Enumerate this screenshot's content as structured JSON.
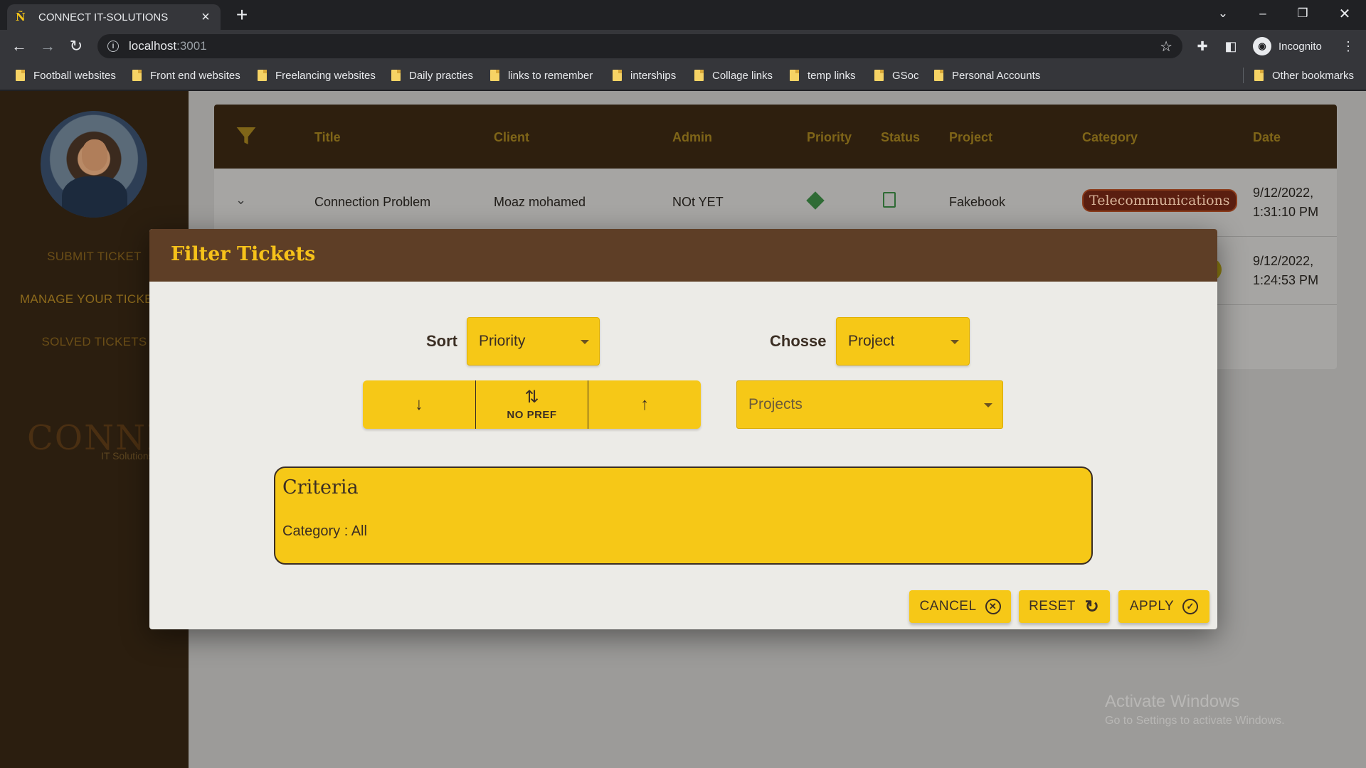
{
  "browser": {
    "tab_title": "CONNECT IT-SOLUTIONS",
    "url_host": "localhost",
    "url_port": ":3001",
    "profile_label": "Incognito",
    "bookmarks": [
      "Football websites",
      "Front end websites",
      "Freelancing websites",
      "Daily practies",
      "links to remember",
      "interships",
      "Collage links",
      "temp links",
      "GSoc",
      "Personal Accounts"
    ],
    "other_bookmarks": "Other bookmarks"
  },
  "sidebar": {
    "links": [
      "SUBMIT TICKET",
      "MANAGE YOUR TICKETS",
      "SOLVED TICKETS"
    ],
    "logo": "CONNECT",
    "logo_sub": "IT Solutions"
  },
  "table": {
    "headers": [
      "Title",
      "Client",
      "Admin",
      "Priority",
      "Status",
      "Project",
      "Category",
      "Date"
    ],
    "rows": [
      {
        "title": "Connection Problem",
        "client": "Moaz mohamed",
        "admin": "NOt YET",
        "project": "Fakebook",
        "category": "Telecommunications",
        "date_line1": "9/12/2022,",
        "date_line2": "1:31:10 PM"
      },
      {
        "date_line1": "9/12/2022,",
        "date_line2": "1:24:53 PM"
      }
    ]
  },
  "dialog": {
    "title": "Filter Tickets",
    "sort_label": "Sort",
    "sort_value": "Priority",
    "choose_label": "Chosse",
    "choose_value": "Project",
    "order_buttons": {
      "no_pref_label": "NO PREF"
    },
    "projects_placeholder": "Projects",
    "criteria_title": "Criteria",
    "criteria_line": "Category : All",
    "cancel_label": "CANCEL",
    "reset_label": "RESET",
    "apply_label": "APPLY"
  },
  "watermark": {
    "line1": "Activate Windows",
    "line2": "Go to Settings to activate Windows."
  },
  "colors": {
    "accent_yellow": "#f6c817",
    "dialog_header": "#5e3e26",
    "sidebar": "#2b1e0f",
    "title_yellow": "#f6c21a"
  }
}
